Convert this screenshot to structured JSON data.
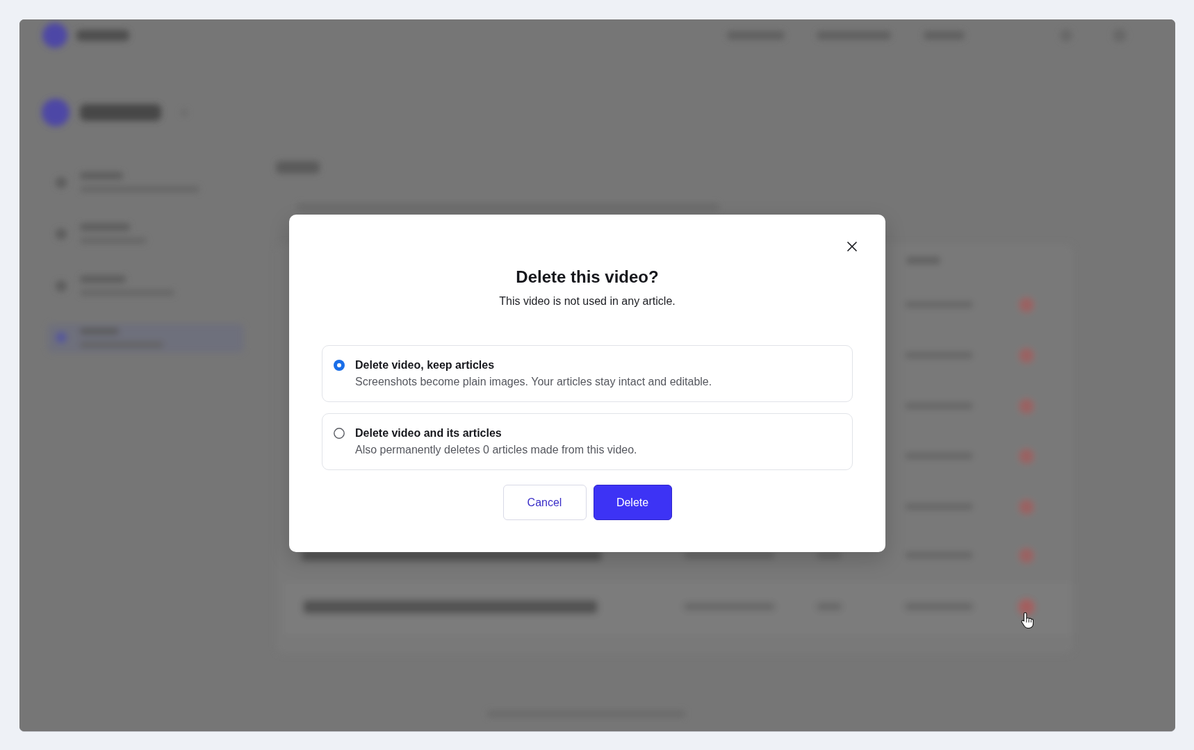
{
  "dialog": {
    "title": "Delete this video?",
    "subtitle": "This video is not used in any article.",
    "options": [
      {
        "label": "Delete video, keep articles",
        "description": "Screenshots become plain images. Your articles stay intact and editable.",
        "selected": true
      },
      {
        "label": "Delete video and its articles",
        "description": "Also permanently deletes 0 articles made from this video.",
        "selected": false
      }
    ],
    "buttons": [
      {
        "label": "Cancel",
        "kind": "secondary"
      },
      {
        "label": "Delete",
        "kind": "primary"
      }
    ]
  }
}
